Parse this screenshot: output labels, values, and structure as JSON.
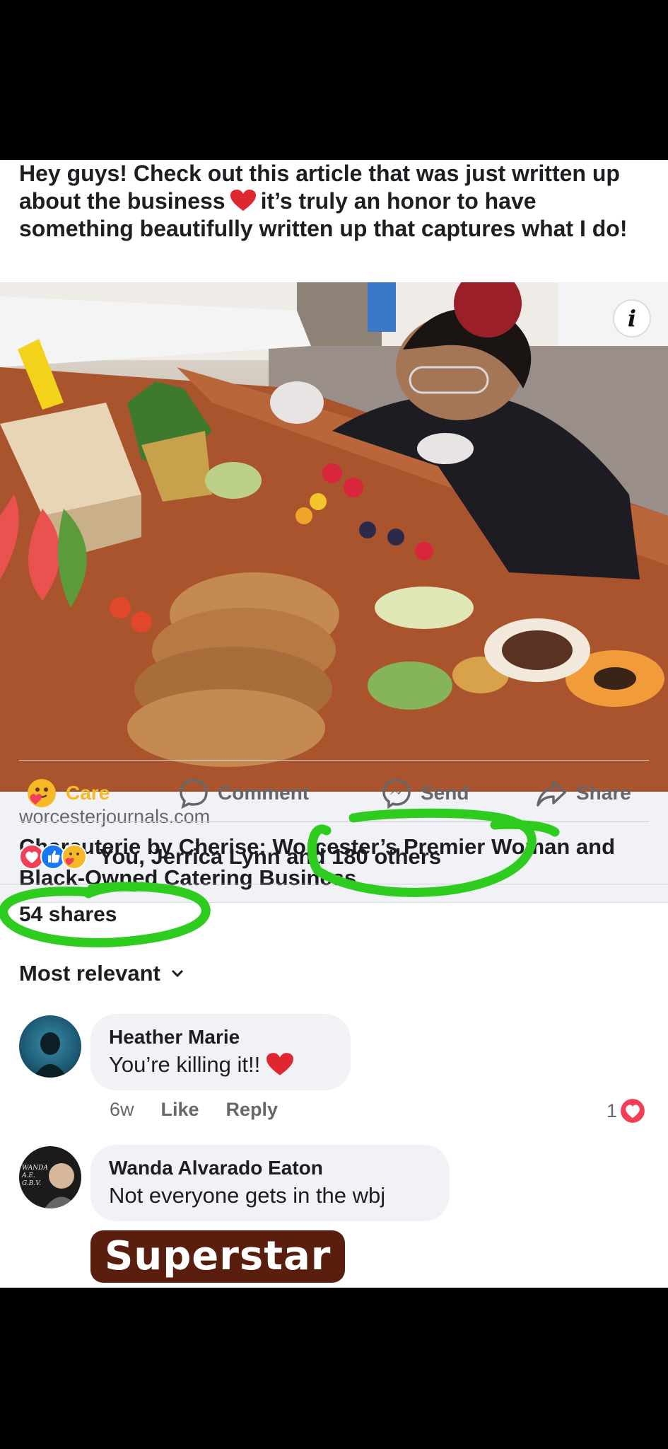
{
  "post": {
    "text_before": "Hey guys! Check out this article that was just written up about the business",
    "text_after": "it’s truly an honor to have something beautifully written up that captures what I do!"
  },
  "link_preview": {
    "info_label": "i",
    "domain": "worcesterjournals.com",
    "title": "Charcuterie by Cherise: Worcester’s Premier Woman and Black-Owned Catering Business"
  },
  "actions": {
    "care": "Care",
    "comment": "Comment",
    "send": "Send",
    "share": "Share"
  },
  "reactions": {
    "summary": "You, Jerrica Lynn and 180 others"
  },
  "shares": "54 shares",
  "sort": {
    "label": "Most relevant"
  },
  "comments": [
    {
      "name": "Heather Marie",
      "text": "You’re killing it!!",
      "time": "6w",
      "like": "Like",
      "reply": "Reply",
      "reaction_count": "1"
    },
    {
      "name": "Wanda Alvarado Eaton",
      "text": "Not everyone gets in the wbj",
      "avatar_text": "WANDA A.E. G.B.V."
    }
  ],
  "sticker": "Superstar",
  "colors": {
    "care": "#f7b928",
    "secondary_text": "#65676b",
    "love": "#f33e58",
    "like": "#1877f2",
    "highlight_marker": "#2ecc1f"
  }
}
